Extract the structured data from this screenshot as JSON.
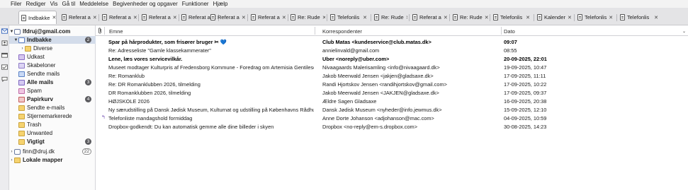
{
  "menu": [
    "Filer",
    "Rediger",
    "Vis",
    "Gå til",
    "Meddelelse",
    "Begivenheder og opgaver",
    "Funktioner",
    "Hjælp"
  ],
  "tabs": [
    {
      "label": "Indbakke",
      "active": true
    },
    {
      "label": "Referat a",
      "active": false
    },
    {
      "label": "Referat a",
      "active": false
    },
    {
      "label": "Referat a",
      "active": false
    },
    {
      "label": "Referat a",
      "active": false
    },
    {
      "label": "Referat a",
      "active": false
    },
    {
      "label": "Referat a",
      "active": false
    },
    {
      "label": "Re: Rude",
      "active": false
    },
    {
      "label": "Telefonlis",
      "active": false
    },
    {
      "label": "Re: Rude",
      "active": false
    },
    {
      "label": "Referat a",
      "active": false
    },
    {
      "label": "Re: Rude",
      "active": false
    },
    {
      "label": "Telefonlis",
      "active": false
    },
    {
      "label": "Kalender",
      "active": false
    },
    {
      "label": "Telefonlis",
      "active": false
    },
    {
      "label": "Telefonlis",
      "active": false
    }
  ],
  "folders": {
    "account1": "lfdruj@gmail.com",
    "inbox": {
      "label": "Indbakke",
      "count": "2"
    },
    "diverse": "Diverse",
    "drafts": "Udkast",
    "templates": "Skabeloner",
    "sent": "Sendte mails",
    "all": {
      "label": "Alle mails",
      "count": "3"
    },
    "spam": "Spam",
    "bin": {
      "label": "Papirkurv",
      "count": "4"
    },
    "sent_emails": "Sendte e-mails",
    "starred": "Stjernemarkerede",
    "trash": "Trash",
    "unwanted": "Unwanted",
    "important": {
      "label": "Vigtigt",
      "count": "3"
    },
    "account2": {
      "label": "finn@druj.dk",
      "count": "22"
    },
    "local": "Lokale mapper"
  },
  "columns": {
    "subject": "Emne",
    "correspondent": "Korrespondenter",
    "date": "Dato"
  },
  "messages": [
    {
      "subject": "Spar på hårprodukter, som frisører bruger ✂",
      "heart": "💙",
      "correspondent": "Club Matas <kundeservice@club.matas.dk>",
      "date": "09:07",
      "unread": true,
      "replied": false
    },
    {
      "subject": "Re: Adresseliste \"Gamle klassekammerater\"",
      "heart": "",
      "correspondent": "annielinvald@gmail.com",
      "date": "08:55",
      "unread": false,
      "replied": false
    },
    {
      "subject": "Lene, læs vores servicevilkår.",
      "heart": "",
      "correspondent": "Uber <noreply@uber.com>",
      "date": "20-09-2025, 22:01",
      "unread": true,
      "replied": false
    },
    {
      "subject": "Museet modtager Kulturpris af Fredensborg Kommune - Foredrag om Artemisia Gentileschi - P...",
      "heart": "",
      "correspondent": "Nivaagaards Malerisamling <info@nivaagaard.dk>",
      "date": "19-09-2025, 10:47",
      "unread": false,
      "replied": false
    },
    {
      "subject": "Re: Romanklub",
      "heart": "",
      "correspondent": "Jakob Meerwald Jensen <jakjen@gladsaxe.dk>",
      "date": "17-09-2025, 11:11",
      "unread": false,
      "replied": false
    },
    {
      "subject": "Re: DR Romanklubben 2026, tilmelding",
      "heart": "",
      "correspondent": "Randi Hjortskov Jensen <randihjortskov@gmail.com>",
      "date": "17-09-2025, 10:22",
      "unread": false,
      "replied": false
    },
    {
      "subject": "DR Romanklubben 2026, tilmelding",
      "heart": "",
      "correspondent": "Jakob Meerwald Jensen <JAKJEN@gladsaxe.dk>",
      "date": "17-09-2025, 09:37",
      "unread": false,
      "replied": false
    },
    {
      "subject": "HØJSKOLE 2026",
      "heart": "",
      "correspondent": "Ældre Sagen Gladsaxe",
      "date": "16-09-2025, 20:38",
      "unread": false,
      "replied": false
    },
    {
      "subject": "Ny særudstilling på Dansk Jødisk Museum, Kulturnat og udstilling på Københavns Rådhus",
      "heart": "",
      "correspondent": "Dansk Jødisk Museum <nyheder@info.jewmus.dk>",
      "date": "15-09-2025, 12:10",
      "unread": false,
      "replied": false
    },
    {
      "subject": "Telefonliste mandagshold formiddag",
      "heart": "",
      "correspondent": "Anne Dorte Johanson <adjohanson@mac.com>",
      "date": "04-09-2025, 10:59",
      "unread": false,
      "replied": true
    },
    {
      "subject": "Dropbox-godkendt: Du kan automatisk gemme alle dine billeder i skyen",
      "heart": "",
      "correspondent": "Dropbox <no-reply@em-s.dropbox.com>",
      "date": "30-08-2025, 14:23",
      "unread": false,
      "replied": false
    }
  ]
}
